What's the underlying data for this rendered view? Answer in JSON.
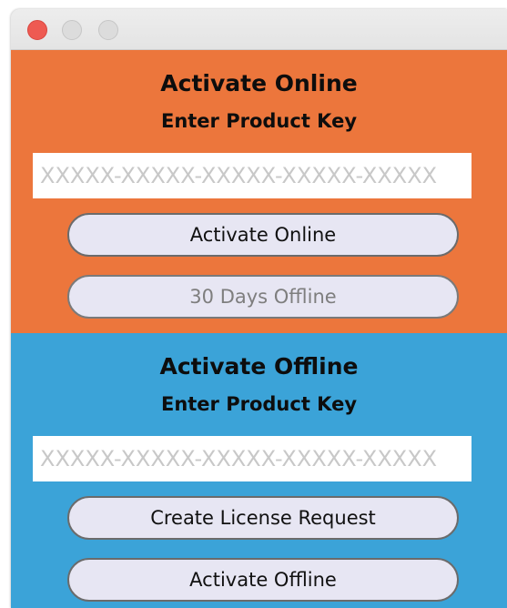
{
  "window": {
    "controls": [
      "close-button",
      "minimize-button",
      "zoom-button"
    ]
  },
  "online": {
    "title": "Activate Online",
    "subtitle": "Enter Product Key",
    "key_placeholder": "XXXXX-XXXXX-XXXXX-XXXXX-XXXXX",
    "key_value": "",
    "activate_button": "Activate Online",
    "trial_button": "30 Days Offline",
    "trial_button_enabled": false,
    "bg_color": "#ec763c"
  },
  "offline": {
    "title": "Activate Offline",
    "subtitle": "Enter Product Key",
    "key_placeholder": "XXXXX-XXXXX-XXXXX-XXXXX-XXXXX",
    "key_value": "",
    "request_button": "Create License Request",
    "activate_button": "Activate Offline",
    "bg_color": "#3ba3d8"
  }
}
